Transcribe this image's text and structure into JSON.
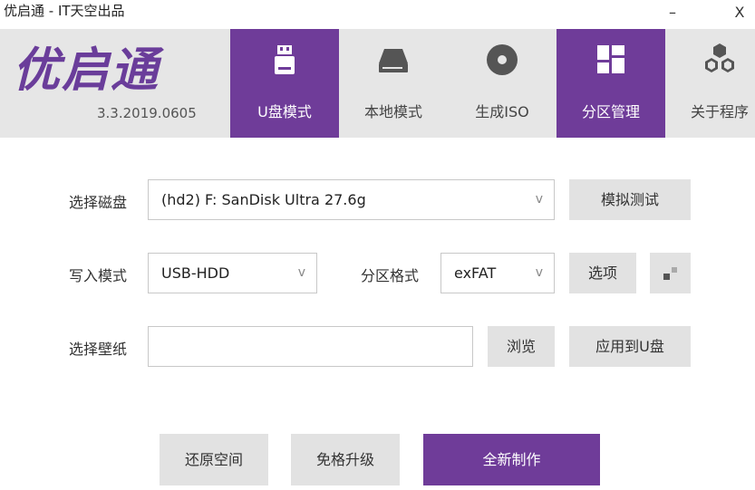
{
  "window": {
    "title": "优启通 - IT天空出品",
    "minimize_label": "–",
    "close_label": "X"
  },
  "header": {
    "logo_text": "优启通",
    "version": "3.3.2019.0605",
    "tabs": [
      {
        "label": "U盘模式",
        "icon": "usb-drive-icon",
        "active": true
      },
      {
        "label": "本地模式",
        "icon": "hard-disk-icon",
        "active": false
      },
      {
        "label": "生成ISO",
        "icon": "disc-icon",
        "active": false
      },
      {
        "label": "分区管理",
        "icon": "partition-grid-icon",
        "active": true
      },
      {
        "label": "关于程序",
        "icon": "hexagons-icon",
        "active": false
      }
    ]
  },
  "form": {
    "disk": {
      "label": "选择磁盘",
      "value": "(hd2) F: SanDisk Ultra 27.6g",
      "test_button": "模拟测试"
    },
    "write_mode": {
      "label": "写入模式",
      "value": "USB-HDD"
    },
    "partition_format": {
      "label": "分区格式",
      "value": "exFAT",
      "options_button": "选项"
    },
    "wallpaper": {
      "label": "选择壁纸",
      "value": "",
      "browse_button": "浏览",
      "apply_button": "应用到U盘"
    }
  },
  "actions": {
    "restore": "还原空间",
    "upgrade": "免格升级",
    "create": "全新制作"
  },
  "colors": {
    "accent": "#6f3c99",
    "header_bg": "#e6e6e6",
    "button_bg": "#e2e2e2"
  }
}
